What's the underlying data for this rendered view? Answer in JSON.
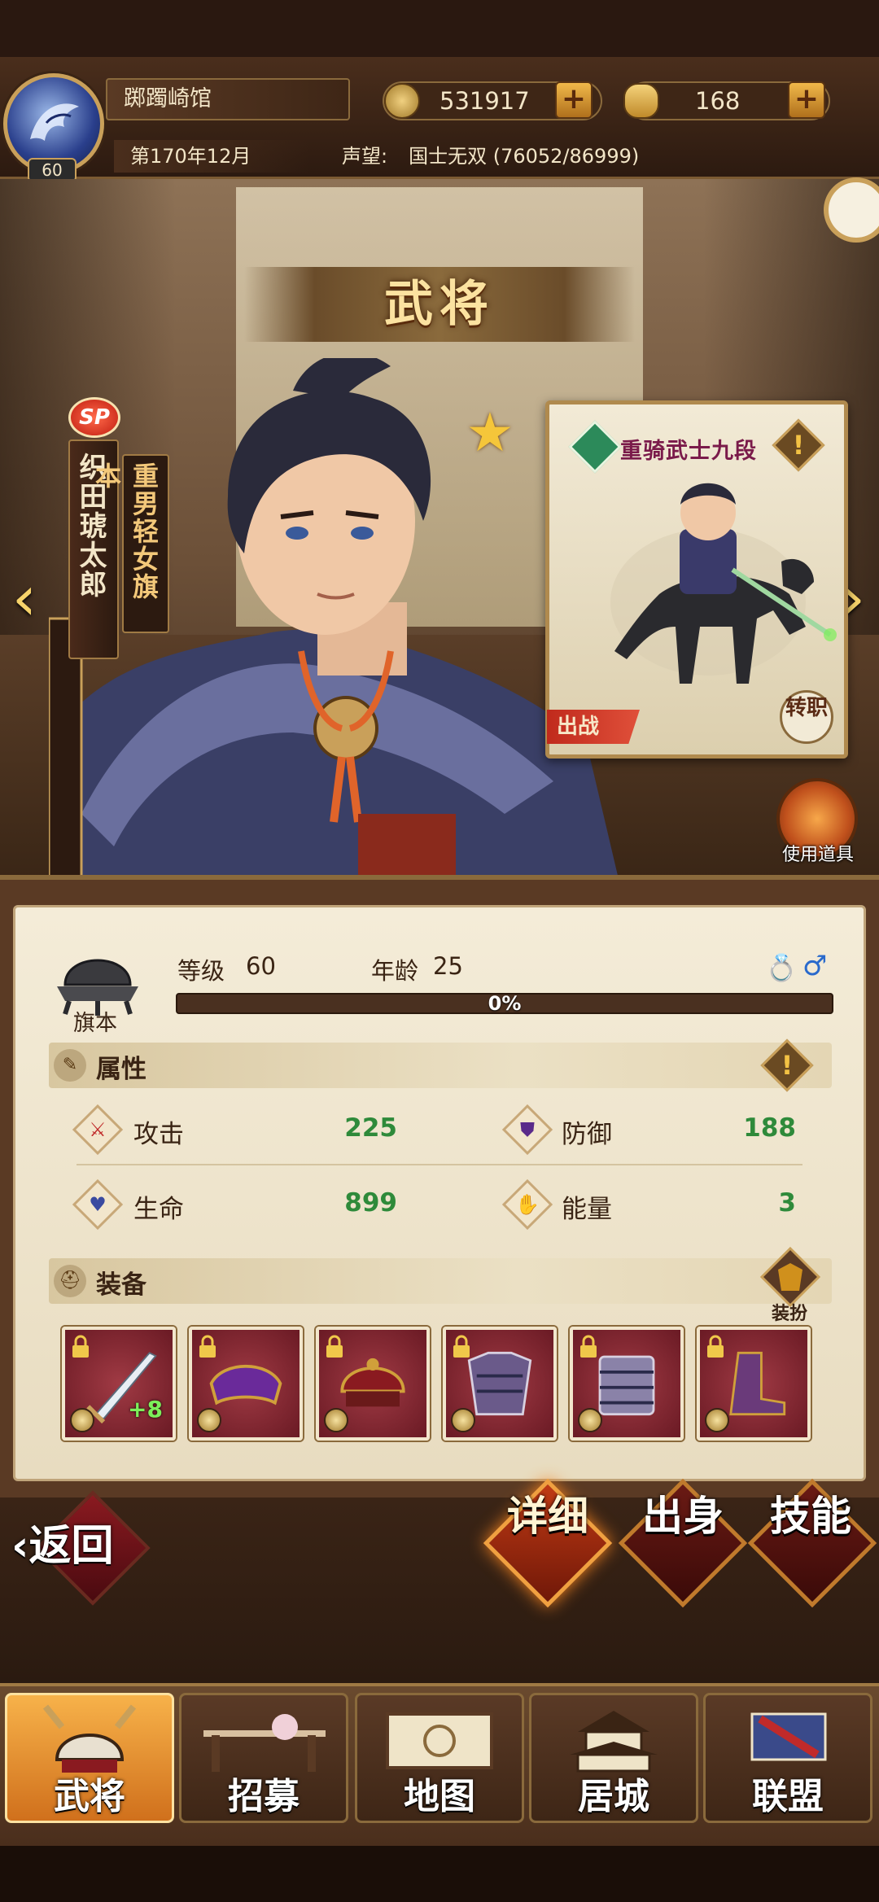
{
  "header": {
    "player_level": "60",
    "location": "踯躅崎馆",
    "coins": "531917",
    "rice": "168",
    "date": "第170年12月",
    "fame_label": "声望:",
    "fame_value": "国士无双 (76052/86999)"
  },
  "page_title": "武将",
  "hero": {
    "rarity": "SP",
    "name": "织田琥太郎",
    "title": "重男轻女旗本",
    "star_icon": "star-icon"
  },
  "unit_card": {
    "class_name": "重骑武士九段",
    "deploy_label": "出战",
    "transfer_label": "转职"
  },
  "use_item_label": "使用道具",
  "stats": {
    "rank_label": "旗本",
    "level_label": "等级",
    "level_value": "60",
    "age_label": "年龄",
    "age_value": "25",
    "xp_percent_text": "0%",
    "xp_fraction": 0.0,
    "attributes_title": "属性",
    "attributes": [
      {
        "label": "攻击",
        "value": "225",
        "icon": "attack-icon"
      },
      {
        "label": "防御",
        "value": "188",
        "icon": "defense-icon"
      },
      {
        "label": "生命",
        "value": "899",
        "icon": "hp-icon"
      },
      {
        "label": "能量",
        "value": "3",
        "icon": "energy-icon"
      }
    ],
    "equipment_title": "装备",
    "outfit_label": "装扮",
    "equipment": [
      {
        "slot": "weapon",
        "icon": "sword-icon",
        "enhance": "+8"
      },
      {
        "slot": "saddle",
        "icon": "saddle-icon",
        "enhance": ""
      },
      {
        "slot": "helmet",
        "icon": "helmet-icon",
        "enhance": ""
      },
      {
        "slot": "armor",
        "icon": "armor-icon",
        "enhance": ""
      },
      {
        "slot": "greaves",
        "icon": "greaves-icon",
        "enhance": ""
      },
      {
        "slot": "boots",
        "icon": "boots-icon",
        "enhance": ""
      }
    ]
  },
  "back_label": "返回",
  "subtabs": [
    {
      "label": "详细",
      "active": true
    },
    {
      "label": "出身",
      "active": false
    },
    {
      "label": "技能",
      "active": false
    }
  ],
  "bottom_nav": [
    {
      "label": "武将",
      "active": true
    },
    {
      "label": "招募",
      "active": false
    },
    {
      "label": "地图",
      "active": false
    },
    {
      "label": "居城",
      "active": false
    },
    {
      "label": "联盟",
      "active": false
    }
  ],
  "colors": {
    "accent_gold": "#d7a64a",
    "stat_value_green": "#2e8a3a",
    "active_orange": "#f08020"
  }
}
